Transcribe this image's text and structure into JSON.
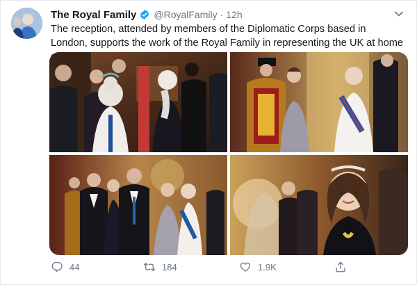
{
  "tweet": {
    "author_name": "The Royal Family",
    "handle": "@RoyalFamily",
    "separator": "·",
    "time": "12h",
    "text": "The reception, attended by members of the Diplomatic Corps based in London, supports the work of the Royal Family in representing the UK at home and abroad.",
    "verified": true
  },
  "media": {
    "count": 4,
    "photos": [
      {
        "subject": "queen-greeting-guest"
      },
      {
        "subject": "duchess-greeting-guest"
      },
      {
        "subject": "couple-greeting-guests"
      },
      {
        "subject": "duchess-smiling"
      }
    ]
  },
  "actions": {
    "reply_icon": "reply-icon",
    "reply_count": "44",
    "retweet_icon": "retweet-icon",
    "retweet_count": "184",
    "like_icon": "heart-icon",
    "like_count": "1.9K",
    "share_icon": "share-icon"
  },
  "colors": {
    "text": "#14171a",
    "secondary": "#657786",
    "verified": "#1da1f2",
    "border": "#e1e8ed"
  }
}
